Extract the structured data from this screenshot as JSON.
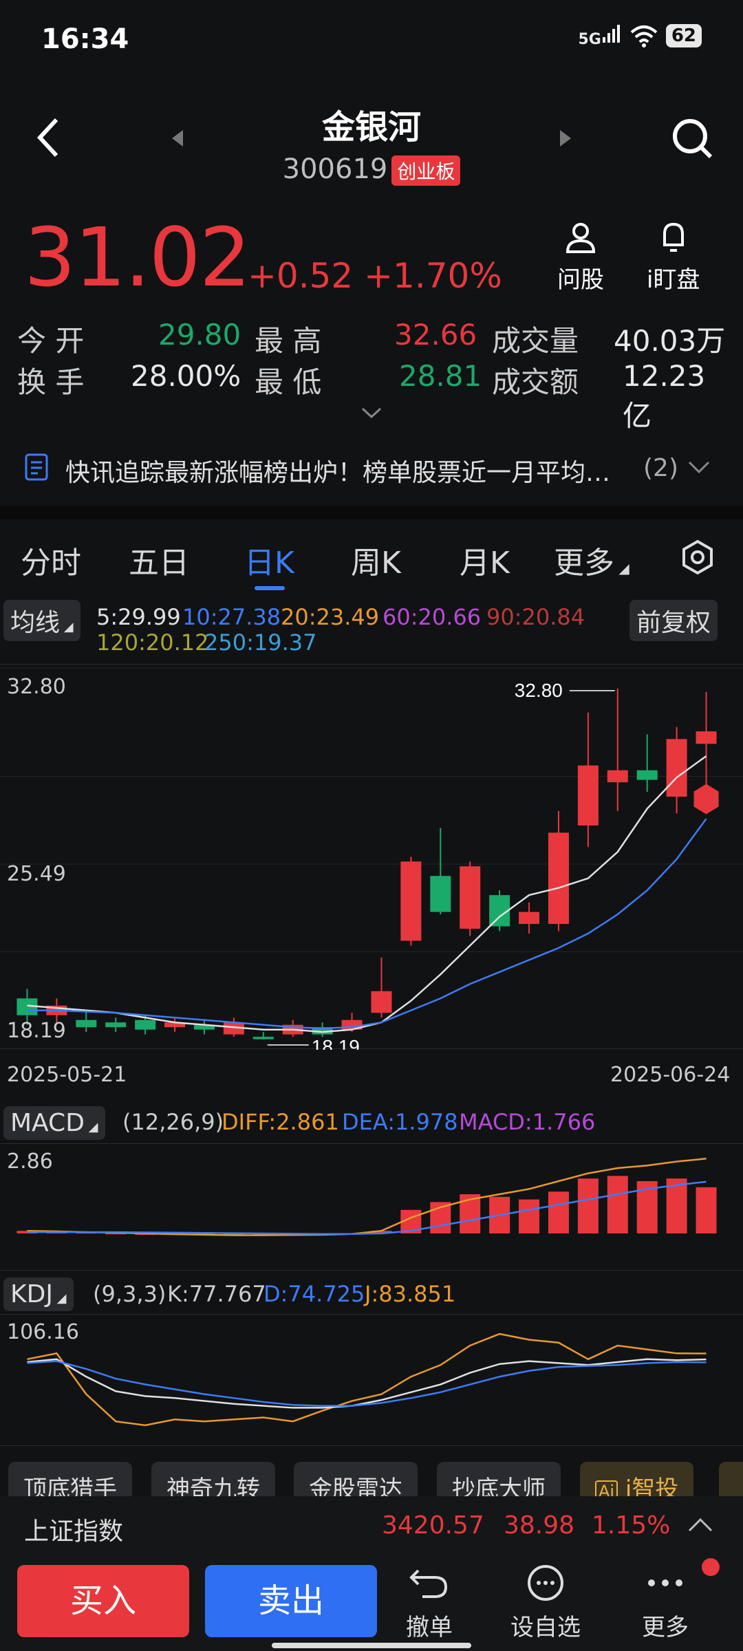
{
  "status_bar": {
    "time": "16:34",
    "network": "5G",
    "battery": "62"
  },
  "header": {
    "title": "金银河",
    "code": "300619",
    "board": "创业板"
  },
  "quote": {
    "price": "31.02",
    "change": "+0.52",
    "change_pct": "+1.70%",
    "btn_ask": "问股",
    "btn_watch": "i盯盘",
    "open_label": "今 开",
    "open": "29.80",
    "high_label": "最 高",
    "high": "32.66",
    "volume_label": "成交量",
    "volume": "40.03万",
    "turnover_label": "换 手",
    "turnover": "28.00%",
    "low_label": "最 低",
    "low": "28.81",
    "amount_label": "成交额",
    "amount": "12.23亿"
  },
  "news": {
    "text": "快讯追踪最新涨幅榜出炉！榜单股票近一月平均…",
    "count": "(2)"
  },
  "tabs": [
    "分时",
    "五日",
    "日K",
    "周K",
    "月K",
    "更多"
  ],
  "active_tab": "日K",
  "ma": {
    "selector": "均线",
    "adjust": "前复权",
    "items": [
      {
        "label": "5:29.99",
        "color": "#e0e0e0"
      },
      {
        "label": "10:27.38",
        "color": "#3d7cf7"
      },
      {
        "label": "20:23.49",
        "color": "#e89a2c"
      },
      {
        "label": "60:20.66",
        "color": "#b84ad8"
      },
      {
        "label": "90:20.84",
        "color": "#b83a3a"
      },
      {
        "label": "120:20.12",
        "color": "#a8a830"
      },
      {
        "label": "250:19.37",
        "color": "#3aa0d8"
      }
    ]
  },
  "chart_data": [
    {
      "type": "candlestick",
      "title": "日K",
      "ylim": [
        18.19,
        32.8
      ],
      "y_ticks": [
        "32.80",
        "25.49",
        "18.19"
      ],
      "x_start": "2025-05-21",
      "x_end": "2025-06-24",
      "max_label": "32.80",
      "min_label": "18.19",
      "candles": [
        {
          "o": 19.9,
          "c": 19.2,
          "h": 20.3,
          "l": 18.8
        },
        {
          "o": 19.2,
          "c": 19.6,
          "h": 19.9,
          "l": 18.9
        },
        {
          "o": 19.0,
          "c": 18.7,
          "h": 19.4,
          "l": 18.5
        },
        {
          "o": 18.9,
          "c": 18.7,
          "h": 19.1,
          "l": 18.5
        },
        {
          "o": 19.0,
          "c": 18.6,
          "h": 19.2,
          "l": 18.4
        },
        {
          "o": 18.7,
          "c": 18.9,
          "h": 19.1,
          "l": 18.5
        },
        {
          "o": 18.8,
          "c": 18.6,
          "h": 19.0,
          "l": 18.4
        },
        {
          "o": 18.4,
          "c": 18.9,
          "h": 19.1,
          "l": 18.3
        },
        {
          "o": 18.3,
          "c": 18.2,
          "h": 18.5,
          "l": 18.19
        },
        {
          "o": 18.4,
          "c": 18.8,
          "h": 19.0,
          "l": 18.3
        },
        {
          "o": 18.7,
          "c": 18.4,
          "h": 18.9,
          "l": 18.3
        },
        {
          "o": 18.6,
          "c": 19.0,
          "h": 19.3,
          "l": 18.5
        },
        {
          "o": 19.3,
          "c": 20.2,
          "h": 21.6,
          "l": 19.1
        },
        {
          "o": 22.3,
          "c": 25.6,
          "h": 25.8,
          "l": 22.1
        },
        {
          "o": 25.0,
          "c": 23.5,
          "h": 27.0,
          "l": 23.4
        },
        {
          "o": 22.8,
          "c": 25.4,
          "h": 25.6,
          "l": 22.5
        },
        {
          "o": 24.2,
          "c": 22.9,
          "h": 24.4,
          "l": 22.7
        },
        {
          "o": 23.0,
          "c": 23.5,
          "h": 23.9,
          "l": 22.6
        },
        {
          "o": 23.0,
          "c": 26.8,
          "h": 27.7,
          "l": 22.7
        },
        {
          "o": 27.1,
          "c": 29.6,
          "h": 31.8,
          "l": 26.2
        },
        {
          "o": 28.9,
          "c": 29.4,
          "h": 32.8,
          "l": 27.7
        },
        {
          "o": 29.4,
          "c": 29.0,
          "h": 30.9,
          "l": 28.5
        },
        {
          "o": 28.3,
          "c": 30.7,
          "h": 31.2,
          "l": 27.6
        },
        {
          "o": 30.5,
          "c": 31.02,
          "h": 32.66,
          "l": 28.81
        }
      ],
      "ma5": [
        19.6,
        19.5,
        19.4,
        19.3,
        19.1,
        18.9,
        18.8,
        18.7,
        18.6,
        18.6,
        18.5,
        18.6,
        18.9,
        19.8,
        20.9,
        22.1,
        23.3,
        24.2,
        24.5,
        24.9,
        26.0,
        27.8,
        29.1,
        29.99
      ],
      "ma10": [
        19.4,
        19.4,
        19.35,
        19.3,
        19.2,
        19.1,
        19.0,
        18.9,
        18.8,
        18.7,
        18.65,
        18.7,
        18.9,
        19.4,
        19.9,
        20.5,
        21.0,
        21.5,
        22.0,
        22.6,
        23.4,
        24.4,
        25.7,
        27.38
      ]
    }
  ],
  "macd": {
    "label": "MACD",
    "params": "(12,26,9)",
    "diff": "DIFF:2.861",
    "dea": "DEA:1.978",
    "macd": "MACD:1.766",
    "top": "2.86",
    "hist": [
      0.1,
      0.08,
      0.05,
      0.02,
      0,
      -0.02,
      -0.03,
      -0.04,
      -0.05,
      -0.03,
      -0.02,
      0.01,
      0.1,
      0.9,
      1.2,
      1.5,
      1.4,
      1.3,
      1.6,
      2.1,
      2.2,
      2.0,
      2.1,
      1.766
    ],
    "diff_series": [
      0.1,
      0.08,
      0.05,
      0.03,
      0.0,
      -0.03,
      -0.05,
      -0.07,
      -0.07,
      -0.06,
      -0.05,
      -0.02,
      0.1,
      0.6,
      1.0,
      1.3,
      1.5,
      1.7,
      2.0,
      2.3,
      2.5,
      2.6,
      2.75,
      2.861
    ],
    "dea_series": [
      0.05,
      0.05,
      0.05,
      0.05,
      0.04,
      0.03,
      0.02,
      0.01,
      0.0,
      -0.01,
      -0.02,
      -0.02,
      0.0,
      0.1,
      0.3,
      0.5,
      0.7,
      0.9,
      1.1,
      1.3,
      1.5,
      1.7,
      1.85,
      1.978
    ]
  },
  "kdj": {
    "label": "KDJ",
    "params": "(9,3,3)",
    "k": "K:77.767",
    "d": "D:74.725",
    "j": "J:83.851",
    "top": "106.16",
    "k_series": [
      75,
      78,
      60,
      45,
      40,
      38,
      35,
      32,
      30,
      28,
      28,
      30,
      36,
      44,
      52,
      64,
      73,
      76,
      74,
      72,
      75,
      78,
      77,
      77.767
    ],
    "d_series": [
      74,
      76,
      68,
      58,
      52,
      47,
      42,
      38,
      34,
      31,
      30,
      30,
      33,
      38,
      44,
      52,
      60,
      66,
      70,
      71,
      72,
      74,
      75,
      74.725
    ],
    "j_series": [
      78,
      84,
      42,
      14,
      10,
      16,
      14,
      16,
      18,
      14,
      25,
      35,
      42,
      60,
      72,
      92,
      104,
      98,
      95,
      78,
      92,
      88,
      84,
      83.851
    ]
  },
  "tools": [
    "顶底猎手",
    "神奇九转",
    "金股雷达",
    "抄底大师",
    "i智投"
  ],
  "index": {
    "name": "上证指数",
    "value": "3420.57",
    "change": "38.98",
    "pct": "1.15%"
  },
  "bottom": {
    "buy": "买入",
    "sell": "卖出",
    "cancel": "撤单",
    "watch": "设自选",
    "more": "更多"
  },
  "colors": {
    "up": "#e8383d",
    "down": "#1aaa6a",
    "accent": "#3d7cf7",
    "bg": "#111214"
  }
}
